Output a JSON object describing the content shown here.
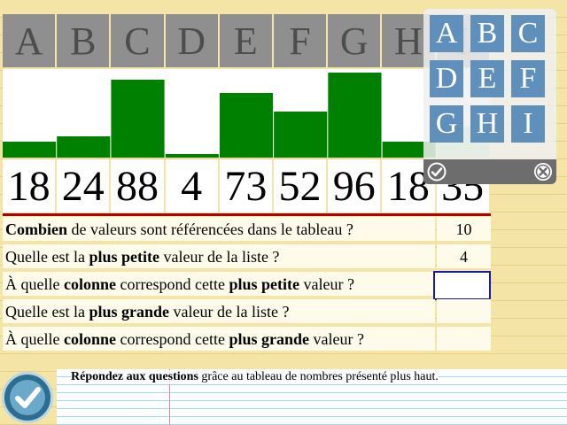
{
  "columns": [
    "A",
    "B",
    "C",
    "D",
    "E",
    "F",
    "G",
    "H",
    "I"
  ],
  "values": [
    "18",
    "24",
    "88",
    "4",
    "73",
    "52",
    "96",
    "18",
    "35"
  ],
  "chart_data": {
    "type": "bar",
    "categories": [
      "A",
      "B",
      "C",
      "D",
      "E",
      "F",
      "G",
      "H",
      "I"
    ],
    "values": [
      18,
      24,
      88,
      4,
      73,
      52,
      96,
      18,
      35
    ],
    "ylim": [
      0,
      100
    ],
    "colors": {
      "bar": "#008000",
      "hidden_bar": "#a8dca0"
    }
  },
  "questions": [
    {
      "parts": [
        {
          "b": "Combien"
        },
        {
          "t": " de valeurs sont référencées dans le tableau ?"
        }
      ],
      "answer": "10"
    },
    {
      "parts": [
        {
          "t": "Quelle est la "
        },
        {
          "b": "plus petite"
        },
        {
          "t": " valeur de la liste ?"
        }
      ],
      "answer": "4"
    },
    {
      "parts": [
        {
          "t": "À quelle "
        },
        {
          "b": "colonne"
        },
        {
          "t": " correspond cette "
        },
        {
          "b": "plus petite"
        },
        {
          "t": " valeur ?"
        }
      ],
      "answer": ""
    },
    {
      "parts": [
        {
          "t": "Quelle est la "
        },
        {
          "b": "plus grande"
        },
        {
          "t": " valeur de la liste ?"
        }
      ],
      "answer": ""
    },
    {
      "parts": [
        {
          "t": "À quelle "
        },
        {
          "b": "colonne"
        },
        {
          "t": " correspond cette "
        },
        {
          "b": "plus grande"
        },
        {
          "t": " valeur ?"
        }
      ],
      "answer": ""
    }
  ],
  "picker": {
    "letters": [
      "A",
      "B",
      "C",
      "D",
      "E",
      "F",
      "G",
      "H",
      "I"
    ],
    "ok_icon": "check-circle-icon",
    "close_icon": "close-circle-icon"
  },
  "footer": {
    "instruction_bold": "Répondez aux questions",
    "instruction_rest": " grâce au tableau de nombres présenté plus haut."
  },
  "colors": {
    "accent_blue": "#5f8fbb",
    "header_gray": "#8f8f8f",
    "bar_green": "#008000",
    "red_line": "#b00000",
    "active_border": "#1a1aa8"
  }
}
